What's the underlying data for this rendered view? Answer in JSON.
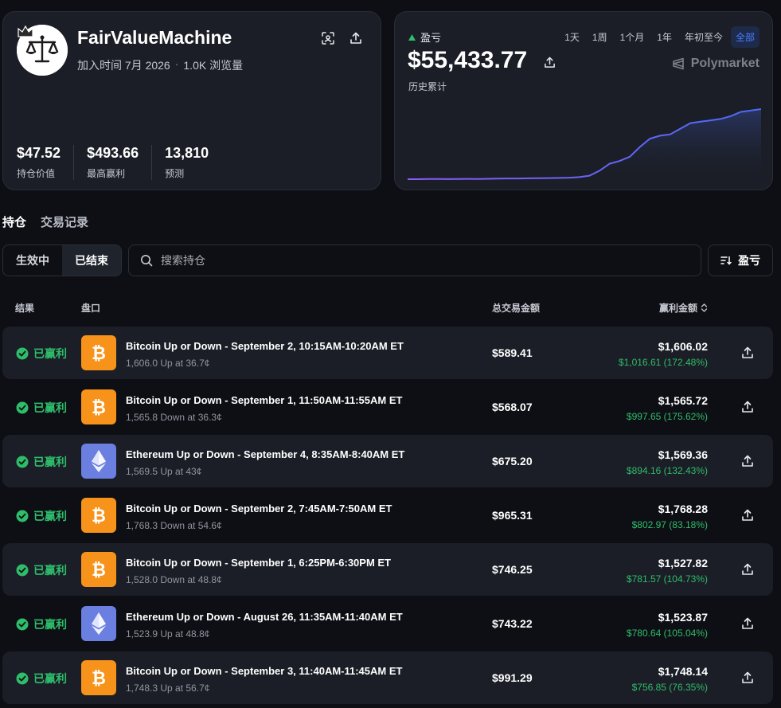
{
  "profile": {
    "name": "FairValueMachine",
    "joined": "加入时间 7月 2026",
    "separator": "·",
    "views": "1.0K 浏览量",
    "stats": [
      {
        "value": "$47.52",
        "label": "持仓价值"
      },
      {
        "value": "$493.66",
        "label": "最高赢利"
      },
      {
        "value": "13,810",
        "label": "预测"
      }
    ]
  },
  "pnl": {
    "label": "盈亏",
    "value": "$55,433.77",
    "sublabel": "历史累计",
    "brand": "Polymarket",
    "ranges": [
      "1天",
      "1周",
      "1个月",
      "1年",
      "年初至今",
      "全部"
    ],
    "active_range": "全部",
    "series": [
      0,
      0,
      0.002,
      0.003,
      0.001,
      0.003,
      0.004,
      0.003,
      0.006,
      0.008,
      0.01,
      0.01,
      0.012,
      0.014,
      0.016,
      0.018,
      0.022,
      0.03,
      0.05,
      0.12,
      0.22,
      0.26,
      0.32,
      0.46,
      0.58,
      0.62,
      0.64,
      0.72,
      0.8,
      0.82,
      0.84,
      0.86,
      0.9,
      0.96,
      0.98,
      1.0
    ],
    "color_start": "#8a5cf6",
    "color_end": "#4a6cf7"
  },
  "tabs": [
    "持仓",
    "交易记录"
  ],
  "segments": [
    "生效中",
    "已结束"
  ],
  "active_segment": "已结束",
  "search": {
    "placeholder": "搜索持仓"
  },
  "sort": {
    "label": "盈亏"
  },
  "table": {
    "headers": {
      "result": "结果",
      "market": "盘口",
      "total": "总交易金额",
      "winnings": "赢利金额"
    },
    "rows": [
      {
        "status": "已赢利",
        "coin": "btc",
        "title": "Bitcoin Up or Down - September 2, 10:15AM-10:20AM ET",
        "sub": "1,606.0 Up at 36.7¢",
        "total": "$589.41",
        "value": "$1,606.02",
        "profit": "$1,016.61 (172.48%)"
      },
      {
        "status": "已赢利",
        "coin": "btc",
        "title": "Bitcoin Up or Down - September 1, 11:50AM-11:55AM ET",
        "sub": "1,565.8 Down at 36.3¢",
        "total": "$568.07",
        "value": "$1,565.72",
        "profit": "$997.65 (175.62%)"
      },
      {
        "status": "已赢利",
        "coin": "eth",
        "title": "Ethereum Up or Down - September 4, 8:35AM-8:40AM ET",
        "sub": "1,569.5 Up at 43¢",
        "total": "$675.20",
        "value": "$1,569.36",
        "profit": "$894.16 (132.43%)"
      },
      {
        "status": "已赢利",
        "coin": "btc",
        "title": "Bitcoin Up or Down - September 2, 7:45AM-7:50AM ET",
        "sub": "1,768.3 Down at 54.6¢",
        "total": "$965.31",
        "value": "$1,768.28",
        "profit": "$802.97 (83.18%)"
      },
      {
        "status": "已赢利",
        "coin": "btc",
        "title": "Bitcoin Up or Down - September 1, 6:25PM-6:30PM ET",
        "sub": "1,528.0 Down at 48.8¢",
        "total": "$746.25",
        "value": "$1,527.82",
        "profit": "$781.57 (104.73%)"
      },
      {
        "status": "已赢利",
        "coin": "eth",
        "title": "Ethereum Up or Down - August 26, 11:35AM-11:40AM ET",
        "sub": "1,523.9 Up at 48.8¢",
        "total": "$743.22",
        "value": "$1,523.87",
        "profit": "$780.64 (105.04%)"
      },
      {
        "status": "已赢利",
        "coin": "btc",
        "title": "Bitcoin Up or Down - September 3, 11:40AM-11:45AM ET",
        "sub": "1,748.3 Up at 56.7¢",
        "total": "$991.29",
        "value": "$1,748.14",
        "profit": "$756.85 (76.35%)"
      }
    ]
  },
  "colors": {
    "background": "#0e0f14",
    "card": "#1b1e26",
    "positive": "#2ebd6b",
    "accent": "#4a7dff",
    "bitcoin": "#f7931a",
    "ethereum": "#6b7fe0"
  }
}
